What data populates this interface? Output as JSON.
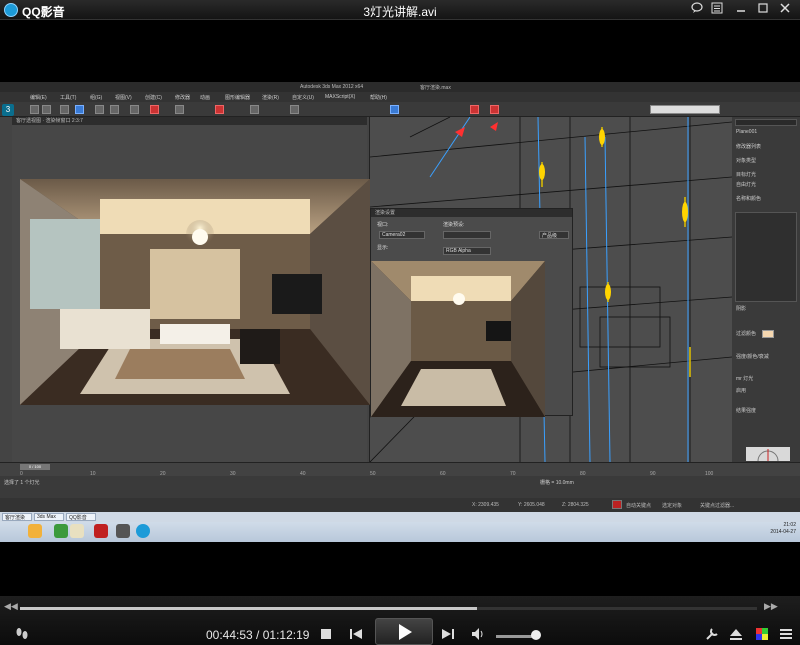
{
  "titlebar": {
    "app_name": "QQ影音",
    "file_title": "3灯光讲解.avi",
    "icons": [
      "chat-icon",
      "list-icon",
      "minimize-icon",
      "maximize-icon",
      "close-icon"
    ]
  },
  "video_frame": {
    "max_window_title": "Autodesk 3ds Max  2012 x64",
    "max_file": "客厅渲染.max",
    "menu_items": [
      "编辑(E)",
      "工具(T)",
      "组(G)",
      "视图(V)",
      "创建(C)",
      "修改器",
      "动画",
      "图形编辑器",
      "渲染(R)",
      "自定义(U)",
      "MAXScript(X)",
      "帮助(H)"
    ],
    "render_window_title": "客厅透视图 · 渲染帧窗口 2:3:7",
    "float_dialog": {
      "title": "渲染设置",
      "row1_label": "视口:",
      "row1_value": "Camera02",
      "row2_label": "渲染预设:",
      "row3_label": "显示:",
      "row3_value": "RGB Alpha",
      "right_value": "产品级"
    },
    "right_panel": {
      "object_name": "Plane001",
      "labels": [
        "修改器列表",
        "对象类型",
        "目标灯光",
        "自由灯光",
        "名称和颜色",
        "阴影",
        "强度/颜色/衰减",
        "过滤颜色",
        "mr 灯光",
        "启用",
        "结果强度"
      ],
      "swatch_color": "#f5d7b0"
    },
    "timeline": {
      "slider_label": "0 / 100",
      "ticks": [
        "0",
        "10",
        "20",
        "30",
        "40",
        "50",
        "60",
        "70",
        "80",
        "90",
        "100"
      ]
    },
    "status": {
      "left": "选择了 1 个灯光",
      "coords": [
        "X: 2309.435",
        "Y: 2605.048",
        "Z: 2804.325"
      ],
      "grid": "栅格 = 10.0mm",
      "key": "自动关键点",
      "selected": "选定对象",
      "filter": "关键点过滤器..."
    },
    "taskbar": {
      "tabs": [
        "客厅渲染",
        "3ds Max",
        "QQ影音"
      ],
      "clock_time": "21:02",
      "clock_date": "2014-04-27"
    }
  },
  "controls": {
    "current_time": "00:44:53",
    "separator": " / ",
    "total_time": "01:12:19",
    "seek_progress": 0.62,
    "volume_level": 0.9,
    "icons": [
      "footprint-icon",
      "stop-icon",
      "previous-icon",
      "play-icon",
      "next-icon",
      "volume-icon",
      "settings-icon",
      "eject-icon",
      "color-icon",
      "menu-icon"
    ]
  }
}
